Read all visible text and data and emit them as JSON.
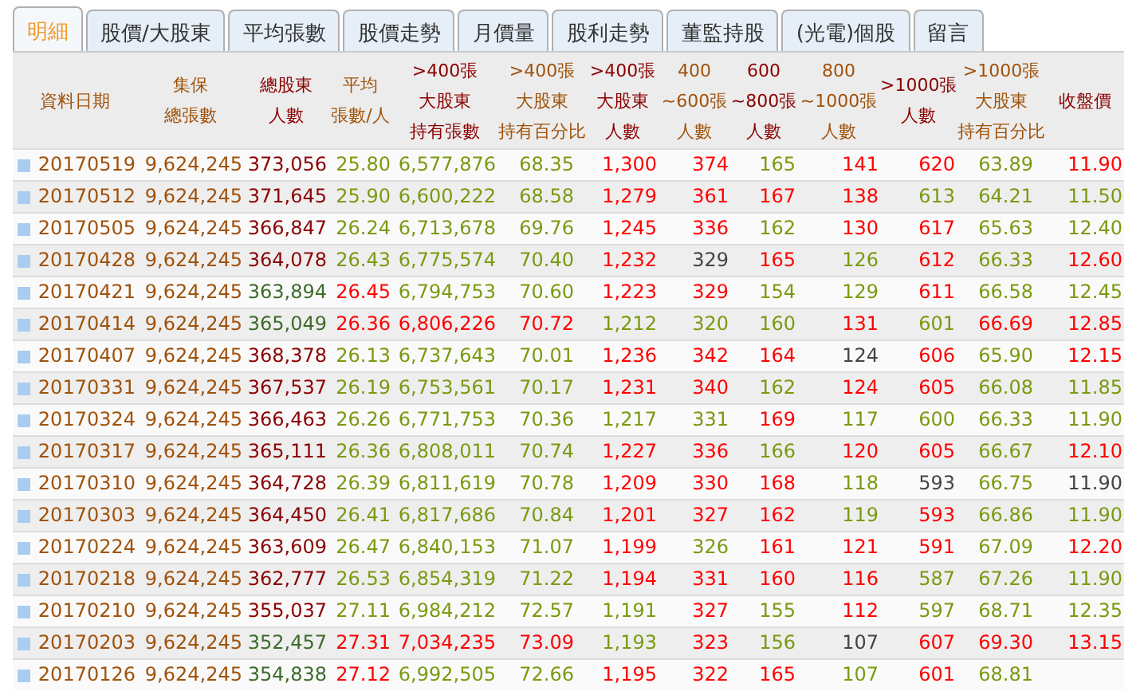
{
  "tabs": [
    {
      "label": "明細",
      "selected": true
    },
    {
      "label": "股價/大股東",
      "selected": false
    },
    {
      "label": "平均張數",
      "selected": false
    },
    {
      "label": "股價走勢",
      "selected": false
    },
    {
      "label": "月價量",
      "selected": false
    },
    {
      "label": "股利走勢",
      "selected": false
    },
    {
      "label": "董監持股",
      "selected": false
    },
    {
      "label": "(光電)個股",
      "selected": false
    },
    {
      "label": "留言",
      "selected": false
    }
  ],
  "columns": [
    {
      "lines": [
        "資料日期"
      ],
      "color": "#a0520a"
    },
    {
      "lines": [
        "集保",
        "總張數"
      ],
      "color": "#a0520a"
    },
    {
      "lines": [
        "總股東",
        "人數"
      ],
      "color": "#8b0000"
    },
    {
      "lines": [
        "平均",
        "張數/人"
      ],
      "color": "#a0520a"
    },
    {
      "lines": [
        ">400張",
        "大股東",
        "持有張數"
      ],
      "color": "#8b0000"
    },
    {
      "lines": [
        ">400張",
        "大股東",
        "持有百分比"
      ],
      "color": "#a0520a"
    },
    {
      "lines": [
        ">400張",
        "大股東",
        "人數"
      ],
      "color": "#8b0000"
    },
    {
      "lines": [
        "400",
        "~600張",
        "人數"
      ],
      "color": "#a0520a"
    },
    {
      "lines": [
        "600",
        "~800張",
        "人數"
      ],
      "color": "#8b0000"
    },
    {
      "lines": [
        "800",
        "~1000張",
        "人數"
      ],
      "color": "#a0520a"
    },
    {
      "lines": [
        ">1000張",
        "人數"
      ],
      "color": "#8b0000"
    },
    {
      "lines": [
        ">1000張",
        "大股東",
        "持有百分比"
      ],
      "color": "#a0520a"
    },
    {
      "lines": [
        "收盤價"
      ],
      "color": "#8b0000"
    }
  ],
  "rows": [
    {
      "date": "20170519",
      "shares": "9,624,245",
      "cells": [
        {
          "text": "373,056",
          "color": "#8b0000"
        },
        {
          "text": "25.80",
          "color": "#7a9a10"
        },
        {
          "text": "6,577,876",
          "color": "#7a9a10"
        },
        {
          "text": "68.35",
          "color": "#7a9a10"
        },
        {
          "text": "1,300",
          "color": "#ff0000"
        },
        {
          "text": "374",
          "color": "#ff0000"
        },
        {
          "text": "165",
          "color": "#7a9a10"
        },
        {
          "text": "141",
          "color": "#ff0000"
        },
        {
          "text": "620",
          "color": "#ff0000"
        },
        {
          "text": "63.89",
          "color": "#7a9a10"
        },
        {
          "text": "11.90",
          "color": "#ff0000"
        }
      ]
    },
    {
      "date": "20170512",
      "shares": "9,624,245",
      "cells": [
        {
          "text": "371,645",
          "color": "#8b0000"
        },
        {
          "text": "25.90",
          "color": "#7a9a10"
        },
        {
          "text": "6,600,222",
          "color": "#7a9a10"
        },
        {
          "text": "68.58",
          "color": "#7a9a10"
        },
        {
          "text": "1,279",
          "color": "#ff0000"
        },
        {
          "text": "361",
          "color": "#ff0000"
        },
        {
          "text": "167",
          "color": "#ff0000"
        },
        {
          "text": "138",
          "color": "#ff0000"
        },
        {
          "text": "613",
          "color": "#7a9a10"
        },
        {
          "text": "64.21",
          "color": "#7a9a10"
        },
        {
          "text": "11.50",
          "color": "#7a9a10"
        }
      ]
    },
    {
      "date": "20170505",
      "shares": "9,624,245",
      "cells": [
        {
          "text": "366,847",
          "color": "#8b0000"
        },
        {
          "text": "26.24",
          "color": "#7a9a10"
        },
        {
          "text": "6,713,678",
          "color": "#7a9a10"
        },
        {
          "text": "69.76",
          "color": "#7a9a10"
        },
        {
          "text": "1,245",
          "color": "#ff0000"
        },
        {
          "text": "336",
          "color": "#ff0000"
        },
        {
          "text": "162",
          "color": "#7a9a10"
        },
        {
          "text": "130",
          "color": "#ff0000"
        },
        {
          "text": "617",
          "color": "#ff0000"
        },
        {
          "text": "65.63",
          "color": "#7a9a10"
        },
        {
          "text": "12.40",
          "color": "#7a9a10"
        }
      ]
    },
    {
      "date": "20170428",
      "shares": "9,624,245",
      "cells": [
        {
          "text": "364,078",
          "color": "#8b0000"
        },
        {
          "text": "26.43",
          "color": "#7a9a10"
        },
        {
          "text": "6,775,574",
          "color": "#7a9a10"
        },
        {
          "text": "70.40",
          "color": "#7a9a10"
        },
        {
          "text": "1,232",
          "color": "#ff0000"
        },
        {
          "text": "329",
          "color": "#444444"
        },
        {
          "text": "165",
          "color": "#ff0000"
        },
        {
          "text": "126",
          "color": "#7a9a10"
        },
        {
          "text": "612",
          "color": "#ff0000"
        },
        {
          "text": "66.33",
          "color": "#7a9a10"
        },
        {
          "text": "12.60",
          "color": "#ff0000"
        }
      ]
    },
    {
      "date": "20170421",
      "shares": "9,624,245",
      "cells": [
        {
          "text": "363,894",
          "color": "#3d6b2a"
        },
        {
          "text": "26.45",
          "color": "#ff0000"
        },
        {
          "text": "6,794,753",
          "color": "#7a9a10"
        },
        {
          "text": "70.60",
          "color": "#7a9a10"
        },
        {
          "text": "1,223",
          "color": "#ff0000"
        },
        {
          "text": "329",
          "color": "#ff0000"
        },
        {
          "text": "154",
          "color": "#7a9a10"
        },
        {
          "text": "129",
          "color": "#7a9a10"
        },
        {
          "text": "611",
          "color": "#ff0000"
        },
        {
          "text": "66.58",
          "color": "#7a9a10"
        },
        {
          "text": "12.45",
          "color": "#7a9a10"
        }
      ]
    },
    {
      "date": "20170414",
      "shares": "9,624,245",
      "cells": [
        {
          "text": "365,049",
          "color": "#3d6b2a"
        },
        {
          "text": "26.36",
          "color": "#ff0000"
        },
        {
          "text": "6,806,226",
          "color": "#ff0000"
        },
        {
          "text": "70.72",
          "color": "#ff0000"
        },
        {
          "text": "1,212",
          "color": "#7a9a10"
        },
        {
          "text": "320",
          "color": "#7a9a10"
        },
        {
          "text": "160",
          "color": "#7a9a10"
        },
        {
          "text": "131",
          "color": "#ff0000"
        },
        {
          "text": "601",
          "color": "#7a9a10"
        },
        {
          "text": "66.69",
          "color": "#ff0000"
        },
        {
          "text": "12.85",
          "color": "#ff0000"
        }
      ]
    },
    {
      "date": "20170407",
      "shares": "9,624,245",
      "cells": [
        {
          "text": "368,378",
          "color": "#8b0000"
        },
        {
          "text": "26.13",
          "color": "#7a9a10"
        },
        {
          "text": "6,737,643",
          "color": "#7a9a10"
        },
        {
          "text": "70.01",
          "color": "#7a9a10"
        },
        {
          "text": "1,236",
          "color": "#ff0000"
        },
        {
          "text": "342",
          "color": "#ff0000"
        },
        {
          "text": "164",
          "color": "#ff0000"
        },
        {
          "text": "124",
          "color": "#444444"
        },
        {
          "text": "606",
          "color": "#ff0000"
        },
        {
          "text": "65.90",
          "color": "#7a9a10"
        },
        {
          "text": "12.15",
          "color": "#ff0000"
        }
      ]
    },
    {
      "date": "20170331",
      "shares": "9,624,245",
      "cells": [
        {
          "text": "367,537",
          "color": "#8b0000"
        },
        {
          "text": "26.19",
          "color": "#7a9a10"
        },
        {
          "text": "6,753,561",
          "color": "#7a9a10"
        },
        {
          "text": "70.17",
          "color": "#7a9a10"
        },
        {
          "text": "1,231",
          "color": "#ff0000"
        },
        {
          "text": "340",
          "color": "#ff0000"
        },
        {
          "text": "162",
          "color": "#7a9a10"
        },
        {
          "text": "124",
          "color": "#ff0000"
        },
        {
          "text": "605",
          "color": "#ff0000"
        },
        {
          "text": "66.08",
          "color": "#7a9a10"
        },
        {
          "text": "11.85",
          "color": "#7a9a10"
        }
      ]
    },
    {
      "date": "20170324",
      "shares": "9,624,245",
      "cells": [
        {
          "text": "366,463",
          "color": "#8b0000"
        },
        {
          "text": "26.26",
          "color": "#7a9a10"
        },
        {
          "text": "6,771,753",
          "color": "#7a9a10"
        },
        {
          "text": "70.36",
          "color": "#7a9a10"
        },
        {
          "text": "1,217",
          "color": "#7a9a10"
        },
        {
          "text": "331",
          "color": "#7a9a10"
        },
        {
          "text": "169",
          "color": "#ff0000"
        },
        {
          "text": "117",
          "color": "#7a9a10"
        },
        {
          "text": "600",
          "color": "#7a9a10"
        },
        {
          "text": "66.33",
          "color": "#7a9a10"
        },
        {
          "text": "11.90",
          "color": "#7a9a10"
        }
      ]
    },
    {
      "date": "20170317",
      "shares": "9,624,245",
      "cells": [
        {
          "text": "365,111",
          "color": "#8b0000"
        },
        {
          "text": "26.36",
          "color": "#7a9a10"
        },
        {
          "text": "6,808,011",
          "color": "#7a9a10"
        },
        {
          "text": "70.74",
          "color": "#7a9a10"
        },
        {
          "text": "1,227",
          "color": "#ff0000"
        },
        {
          "text": "336",
          "color": "#ff0000"
        },
        {
          "text": "166",
          "color": "#7a9a10"
        },
        {
          "text": "120",
          "color": "#ff0000"
        },
        {
          "text": "605",
          "color": "#ff0000"
        },
        {
          "text": "66.67",
          "color": "#7a9a10"
        },
        {
          "text": "12.10",
          "color": "#ff0000"
        }
      ]
    },
    {
      "date": "20170310",
      "shares": "9,624,245",
      "cells": [
        {
          "text": "364,728",
          "color": "#8b0000"
        },
        {
          "text": "26.39",
          "color": "#7a9a10"
        },
        {
          "text": "6,811,619",
          "color": "#7a9a10"
        },
        {
          "text": "70.78",
          "color": "#7a9a10"
        },
        {
          "text": "1,209",
          "color": "#ff0000"
        },
        {
          "text": "330",
          "color": "#ff0000"
        },
        {
          "text": "168",
          "color": "#ff0000"
        },
        {
          "text": "118",
          "color": "#7a9a10"
        },
        {
          "text": "593",
          "color": "#444444"
        },
        {
          "text": "66.75",
          "color": "#7a9a10"
        },
        {
          "text": "11.90",
          "color": "#444444"
        }
      ]
    },
    {
      "date": "20170303",
      "shares": "9,624,245",
      "cells": [
        {
          "text": "364,450",
          "color": "#8b0000"
        },
        {
          "text": "26.41",
          "color": "#7a9a10"
        },
        {
          "text": "6,817,686",
          "color": "#7a9a10"
        },
        {
          "text": "70.84",
          "color": "#7a9a10"
        },
        {
          "text": "1,201",
          "color": "#ff0000"
        },
        {
          "text": "327",
          "color": "#ff0000"
        },
        {
          "text": "162",
          "color": "#ff0000"
        },
        {
          "text": "119",
          "color": "#7a9a10"
        },
        {
          "text": "593",
          "color": "#ff0000"
        },
        {
          "text": "66.86",
          "color": "#7a9a10"
        },
        {
          "text": "11.90",
          "color": "#7a9a10"
        }
      ]
    },
    {
      "date": "20170224",
      "shares": "9,624,245",
      "cells": [
        {
          "text": "363,609",
          "color": "#8b0000"
        },
        {
          "text": "26.47",
          "color": "#7a9a10"
        },
        {
          "text": "6,840,153",
          "color": "#7a9a10"
        },
        {
          "text": "71.07",
          "color": "#7a9a10"
        },
        {
          "text": "1,199",
          "color": "#ff0000"
        },
        {
          "text": "326",
          "color": "#7a9a10"
        },
        {
          "text": "161",
          "color": "#ff0000"
        },
        {
          "text": "121",
          "color": "#ff0000"
        },
        {
          "text": "591",
          "color": "#ff0000"
        },
        {
          "text": "67.09",
          "color": "#7a9a10"
        },
        {
          "text": "12.20",
          "color": "#ff0000"
        }
      ]
    },
    {
      "date": "20170218",
      "shares": "9,624,245",
      "cells": [
        {
          "text": "362,777",
          "color": "#8b0000"
        },
        {
          "text": "26.53",
          "color": "#7a9a10"
        },
        {
          "text": "6,854,319",
          "color": "#7a9a10"
        },
        {
          "text": "71.22",
          "color": "#7a9a10"
        },
        {
          "text": "1,194",
          "color": "#ff0000"
        },
        {
          "text": "331",
          "color": "#ff0000"
        },
        {
          "text": "160",
          "color": "#ff0000"
        },
        {
          "text": "116",
          "color": "#ff0000"
        },
        {
          "text": "587",
          "color": "#7a9a10"
        },
        {
          "text": "67.26",
          "color": "#7a9a10"
        },
        {
          "text": "11.90",
          "color": "#7a9a10"
        }
      ]
    },
    {
      "date": "20170210",
      "shares": "9,624,245",
      "cells": [
        {
          "text": "355,037",
          "color": "#8b0000"
        },
        {
          "text": "27.11",
          "color": "#7a9a10"
        },
        {
          "text": "6,984,212",
          "color": "#7a9a10"
        },
        {
          "text": "72.57",
          "color": "#7a9a10"
        },
        {
          "text": "1,191",
          "color": "#7a9a10"
        },
        {
          "text": "327",
          "color": "#ff0000"
        },
        {
          "text": "155",
          "color": "#7a9a10"
        },
        {
          "text": "112",
          "color": "#ff0000"
        },
        {
          "text": "597",
          "color": "#7a9a10"
        },
        {
          "text": "68.71",
          "color": "#7a9a10"
        },
        {
          "text": "12.35",
          "color": "#7a9a10"
        }
      ]
    },
    {
      "date": "20170203",
      "shares": "9,624,245",
      "cells": [
        {
          "text": "352,457",
          "color": "#3d6b2a"
        },
        {
          "text": "27.31",
          "color": "#ff0000"
        },
        {
          "text": "7,034,235",
          "color": "#ff0000"
        },
        {
          "text": "73.09",
          "color": "#ff0000"
        },
        {
          "text": "1,193",
          "color": "#7a9a10"
        },
        {
          "text": "323",
          "color": "#ff0000"
        },
        {
          "text": "156",
          "color": "#7a9a10"
        },
        {
          "text": "107",
          "color": "#444444"
        },
        {
          "text": "607",
          "color": "#ff0000"
        },
        {
          "text": "69.30",
          "color": "#ff0000"
        },
        {
          "text": "13.15",
          "color": "#ff0000"
        }
      ]
    },
    {
      "date": "20170126",
      "shares": "9,624,245",
      "cells": [
        {
          "text": "354,838",
          "color": "#3d6b2a"
        },
        {
          "text": "27.12",
          "color": "#ff0000"
        },
        {
          "text": "6,992,505",
          "color": "#7a9a10"
        },
        {
          "text": "72.66",
          "color": "#7a9a10"
        },
        {
          "text": "1,195",
          "color": "#ff0000"
        },
        {
          "text": "322",
          "color": "#ff0000"
        },
        {
          "text": "165",
          "color": "#ff0000"
        },
        {
          "text": "107",
          "color": "#7a9a10"
        },
        {
          "text": "601",
          "color": "#ff0000"
        },
        {
          "text": "68.81",
          "color": "#7a9a10"
        }
      ]
    }
  ]
}
